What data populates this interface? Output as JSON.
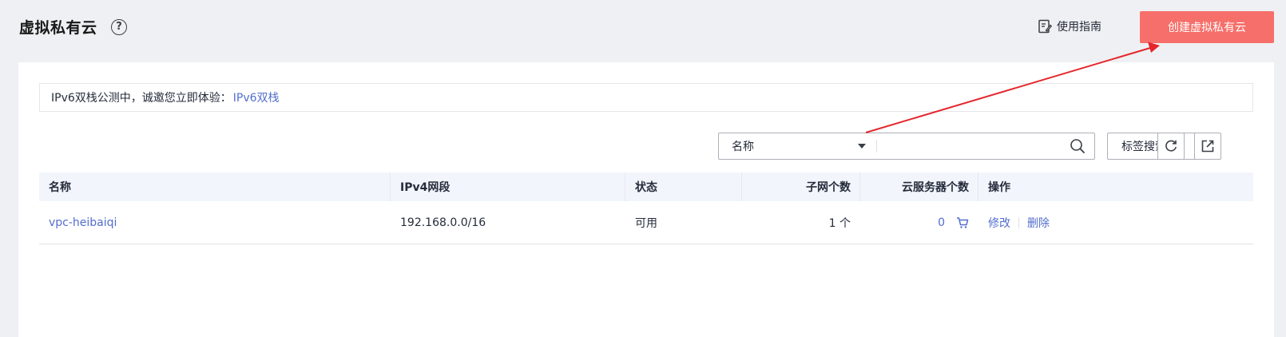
{
  "header": {
    "title": "虚拟私有云",
    "help_symbol": "?",
    "guide_label": "使用指南",
    "create_button_label": "创建虚拟私有云"
  },
  "notice": {
    "text": "IPv6双栈公测中，诚邀您立即体验：",
    "link_label": "IPv6双栈"
  },
  "toolbar": {
    "filter_field_selected": "名称",
    "search_value": "",
    "tag_search_label": "标签搜索"
  },
  "table": {
    "columns": [
      "名称",
      "IPv4网段",
      "状态",
      "子网个数",
      "云服务器个数",
      "操作"
    ],
    "rows": [
      {
        "name": "vpc-heibaiqi",
        "ipv4_cidr": "192.168.0.0/16",
        "status": "可用",
        "subnet_count": "1 个",
        "server_count": "0",
        "actions": [
          "修改",
          "删除"
        ]
      }
    ]
  },
  "colors": {
    "accent": "#f66f6a",
    "link": "#526ecc",
    "annotation_arrow": "#e4262c"
  },
  "icons": {
    "help": "question-circle-icon",
    "guide": "guide-document-icon",
    "search": "search-icon",
    "tag_search": "double-chevron-down-icon",
    "refresh": "refresh-icon",
    "export": "export-icon",
    "buy_server": "cart-icon"
  }
}
